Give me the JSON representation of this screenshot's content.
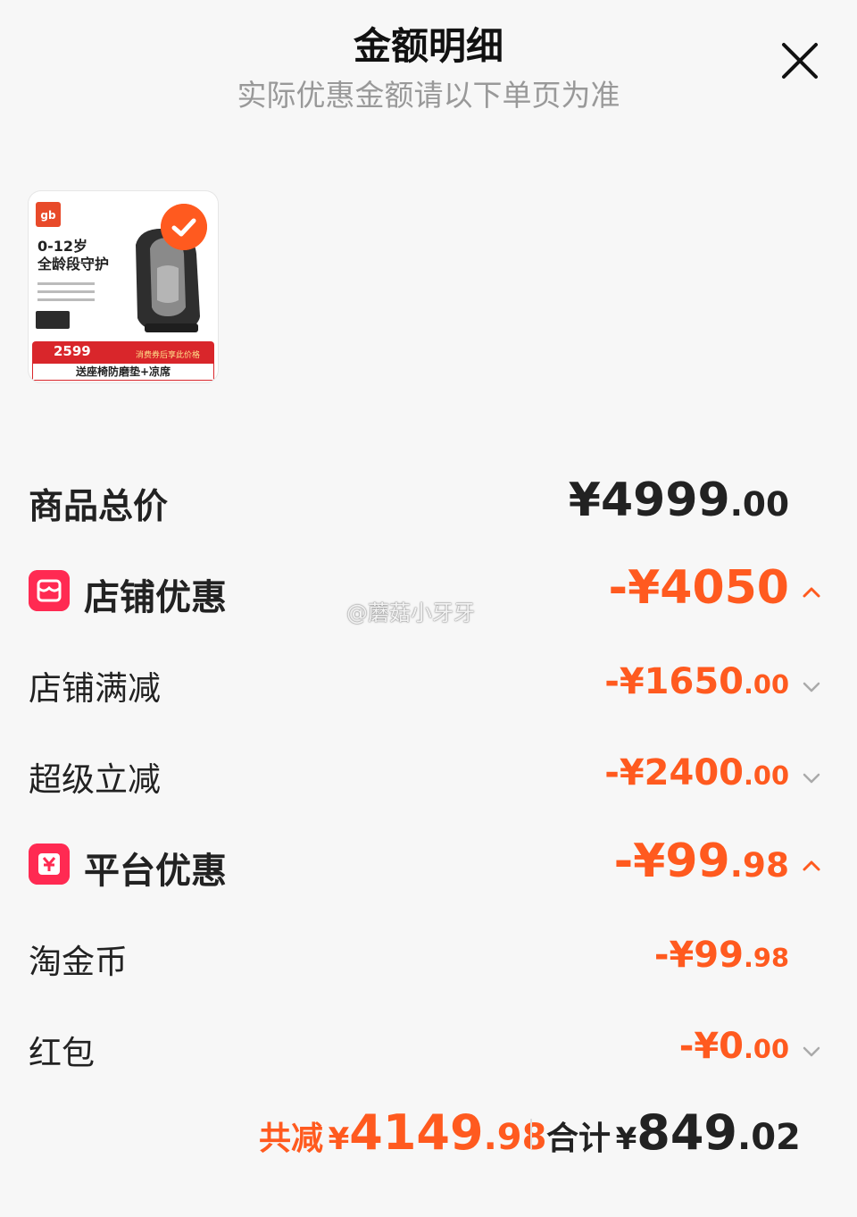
{
  "header": {
    "title": "金额明细",
    "subtitle": "实际优惠金额请以下单页为准"
  },
  "product": {
    "brand": "gb",
    "age_range": "0-12岁",
    "slogan": "全龄段守护",
    "promo_price": "2599",
    "promo_note": "消费券后享此价格",
    "gift": "送座椅防磨垫+凉席",
    "selected": true
  },
  "summary": {
    "total_label": "商品总价",
    "total_value": "¥4999",
    "total_decimals": ".00"
  },
  "store_discount": {
    "label": "店铺优惠",
    "value": "-¥4050",
    "items": [
      {
        "label": "店铺满减",
        "value": "-¥1650",
        "decimals": ".00"
      },
      {
        "label": "超级立减",
        "value": "-¥2400",
        "decimals": ".00"
      }
    ]
  },
  "platform_discount": {
    "label": "平台优惠",
    "value": "-¥99",
    "decimals": ".98",
    "items": [
      {
        "label": "淘金币",
        "value": "-¥99",
        "decimals": ".98"
      },
      {
        "label": "红包",
        "value": "-¥0",
        "decimals": ".00"
      }
    ]
  },
  "watermark": "@蘑菇小牙牙",
  "footer": {
    "saved_label": "共减",
    "saved_currency": "¥",
    "saved_value": "4149",
    "saved_decimals": ".98",
    "total_label": "合计",
    "total_currency": "¥",
    "total_value": "849",
    "total_decimals": ".02"
  },
  "colors": {
    "accent": "#ff5a1f",
    "icon_red": "#ff2a52",
    "subtitle_gray": "#999999"
  },
  "icons": {
    "close": "close-icon",
    "store": "store-icon",
    "platform": "coupon-icon",
    "expand": "chevron-up-icon",
    "collapse": "chevron-down-icon"
  }
}
